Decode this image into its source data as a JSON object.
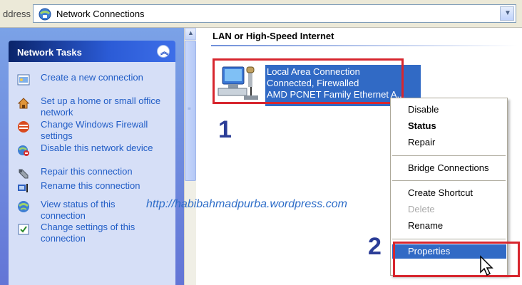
{
  "address_bar": {
    "label": "ddress",
    "value": "Network Connections",
    "icon": "network-connections-icon"
  },
  "tasks_panel": {
    "title": "Network Tasks",
    "items": [
      {
        "label": "Create a new connection",
        "icon": "new-connection-icon"
      },
      {
        "label": "Set up a home or small office network",
        "icon": "home-network-icon"
      },
      {
        "label": "Change Windows Firewall settings",
        "icon": "firewall-icon"
      },
      {
        "label": "Disable this network device",
        "icon": "disable-device-icon"
      },
      {
        "label": "Repair this connection",
        "icon": "repair-icon"
      },
      {
        "label": "Rename this connection",
        "icon": "rename-icon"
      },
      {
        "label": "View status of this connection",
        "icon": "status-icon"
      },
      {
        "label": "Change settings of this connection",
        "icon": "settings-icon"
      }
    ]
  },
  "content": {
    "group_header": "LAN or High-Speed Internet",
    "connection": {
      "name": "Local Area Connection",
      "status": "Connected, Firewalled",
      "device": "AMD PCNET Family Ethernet A..."
    }
  },
  "annotations": {
    "step1": "1",
    "step2": "2",
    "watermark": "http://habibahmadpurba.wordpress.com"
  },
  "context_menu": {
    "items": [
      "Disable",
      "Status",
      "Repair",
      "Bridge Connections",
      "Create Shortcut",
      "Delete",
      "Rename",
      "Properties"
    ],
    "default_item": "Status",
    "disabled_item": "Delete",
    "highlighted_item": "Properties"
  },
  "colors": {
    "selection": "#316ac5",
    "link": "#215dc6",
    "annotation_box": "#d7262e",
    "step_number": "#2b3d97"
  }
}
